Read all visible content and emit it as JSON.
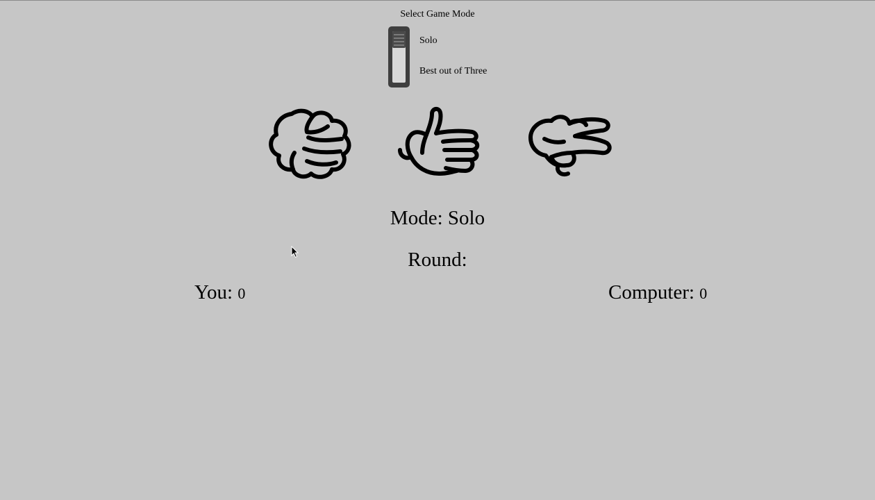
{
  "mode_selector": {
    "title": "Select Game Mode",
    "options": [
      "Solo",
      "Best out of Three"
    ],
    "selected": "Solo"
  },
  "choices": [
    {
      "name": "rock",
      "icon": "rock-hand-icon"
    },
    {
      "name": "paper",
      "icon": "paper-hand-icon"
    },
    {
      "name": "scissors",
      "icon": "scissors-hand-icon"
    }
  ],
  "status": {
    "mode_label": "Mode:",
    "mode_value": "Solo",
    "round_label": "Round:",
    "round_value": ""
  },
  "scores": {
    "you_label": "You:",
    "you_value": "0",
    "computer_label": "Computer:",
    "computer_value": "0"
  },
  "colors": {
    "background": "#c6c6c6",
    "switch": "#3f3f3f"
  }
}
